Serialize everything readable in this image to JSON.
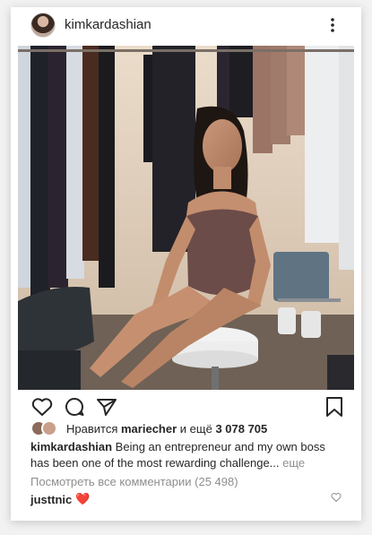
{
  "post": {
    "username": "kimkardashian",
    "likes": {
      "prefix": "Нравится",
      "user": "mariecher",
      "middle": "и ещё",
      "count": "3 078 705"
    },
    "caption": {
      "username": "kimkardashian",
      "text": "Being an entrepreneur and my own boss has been one of the most rewarding challenge...",
      "more": "еще"
    },
    "view_comments": "Посмотреть все комментарии (25 498)",
    "comment": {
      "username": "justtnic",
      "emoji": "❤️"
    }
  },
  "icons": {
    "more": "more-vertical-icon",
    "like": "heart-icon",
    "comment": "comment-icon",
    "share": "send-icon",
    "save": "bookmark-icon"
  },
  "colors": {
    "text": "#262626",
    "muted": "#8e8e8e",
    "heart_red": "#ed4956"
  }
}
